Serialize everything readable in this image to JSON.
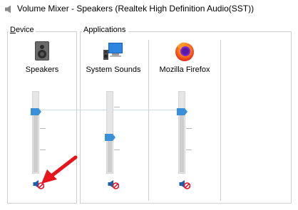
{
  "window": {
    "title": "Volume Mixer - Speakers (Realtek High Definition Audio(SST))"
  },
  "sections": {
    "device_first": "D",
    "device_rest": "evice",
    "applications": "Applications"
  },
  "channels": [
    {
      "label": "Speakers",
      "icon": "speaker-device-icon",
      "volume": 0.66,
      "muted": true
    },
    {
      "label": "System Sounds",
      "icon": "system-sounds-icon",
      "volume": 0.36,
      "muted": true
    },
    {
      "label": "Mozilla Firefox",
      "icon": "firefox-icon",
      "volume": 0.66,
      "muted": true
    }
  ],
  "colors": {
    "thumb": "#3a8fd9",
    "mute_red": "#e81123",
    "arrow_red": "#e8141c"
  }
}
